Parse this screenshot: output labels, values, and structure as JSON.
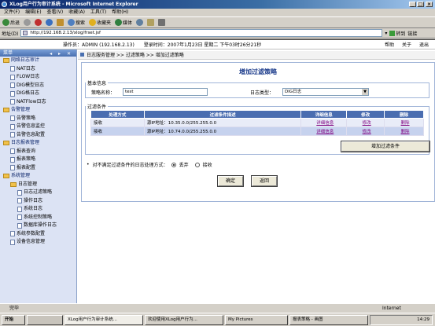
{
  "window": {
    "title": "XLog用户行为审计系统 - Microsoft Internet Explorer"
  },
  "menu": [
    "文件(F)",
    "编辑(E)",
    "查看(V)",
    "收藏(A)",
    "工具(T)",
    "帮助(H)"
  ],
  "toolbar": {
    "back": "后退",
    "search": "搜索",
    "favorites": "收藏夹",
    "media": "媒体"
  },
  "address": {
    "label": "地址(D)",
    "value": "http://192.168.2.13/xlog/frset.jsf",
    "go": "转到",
    "links": "链接"
  },
  "header": {
    "operator": "操作员：ADMIN (192.168.2.13)",
    "login_time": "登录时间：2007年1月23日 星期二 下午03时26分21秒",
    "links": [
      "帮助",
      "关于",
      "退出"
    ]
  },
  "sidebar": {
    "title": "菜单",
    "controls": "◂ ▸ ✕",
    "items": [
      {
        "label": "网络日志审计",
        "level": 0,
        "type": "folder"
      },
      {
        "label": "NAT日志",
        "level": 1,
        "type": "doc"
      },
      {
        "label": "FLOW日志",
        "level": 1,
        "type": "doc"
      },
      {
        "label": "DIG模型日志",
        "level": 1,
        "type": "doc"
      },
      {
        "label": "DIG格日志",
        "level": 1,
        "type": "doc"
      },
      {
        "label": "NATFlow日志",
        "level": 1,
        "type": "doc"
      },
      {
        "label": "告警管理",
        "level": 0,
        "type": "folder"
      },
      {
        "label": "告警策略",
        "level": 1,
        "type": "doc"
      },
      {
        "label": "告警信息监控",
        "level": 1,
        "type": "doc"
      },
      {
        "label": "告警信息配置",
        "level": 1,
        "type": "doc"
      },
      {
        "label": "日志报表管理",
        "level": 0,
        "type": "folder"
      },
      {
        "label": "报表查询",
        "level": 1,
        "type": "doc"
      },
      {
        "label": "报表策略",
        "level": 1,
        "type": "doc"
      },
      {
        "label": "报表配置",
        "level": 1,
        "type": "doc"
      },
      {
        "label": "系统管理",
        "level": 0,
        "type": "folder"
      },
      {
        "label": "日志管理",
        "level": 1,
        "type": "folder"
      },
      {
        "label": "日志过滤策略",
        "level": 2,
        "type": "doc"
      },
      {
        "label": "操作日志",
        "level": 2,
        "type": "doc"
      },
      {
        "label": "系统日志",
        "level": 2,
        "type": "doc"
      },
      {
        "label": "系统控制策略",
        "level": 2,
        "type": "doc"
      },
      {
        "label": "数据库操作日志",
        "level": 2,
        "type": "doc"
      },
      {
        "label": "系统参数配置",
        "level": 1,
        "type": "doc"
      },
      {
        "label": "设备信息管理",
        "level": 1,
        "type": "doc"
      }
    ]
  },
  "breadcrumb": "日志服务管理 >> 过滤策略 >> 增加过滤策略",
  "form": {
    "title": "增加过滤策略",
    "basic_legend": "基本信息",
    "name_label": "策略名称：",
    "name_value": "test",
    "type_label": "日志类型：",
    "type_value": "DIG日志",
    "cond_legend": "过滤条件",
    "columns": [
      "处理方式",
      "过滤条件描述",
      "详细信息",
      "修改",
      "删除"
    ],
    "rows": [
      {
        "action": "接收",
        "desc": "源IP地址：10.35.0.0/255.255.0.0",
        "detail": "详细信息",
        "edit": "修改",
        "delete": "删除"
      },
      {
        "action": "接收",
        "desc": "源IP地址：10.74.0.0/255.255.0.0",
        "detail": "详细信息",
        "edit": "修改",
        "delete": "删除"
      }
    ],
    "add_cond_button": "增加过滤条件",
    "default_label": "对不满足过滤条件的日志处理方式：",
    "opt_discard": "丢弃",
    "opt_accept": "接收",
    "ok": "确定",
    "back": "返回"
  },
  "statusbar": {
    "text": "完毕",
    "zone": "Internet"
  },
  "taskbar": {
    "start": "开始",
    "tasks": [
      "XLog用户行为审计系统...",
      "欢迎使用XLog用户行为...",
      "My Pictures",
      "报表策略 - 画图"
    ],
    "clock": "14:29"
  }
}
